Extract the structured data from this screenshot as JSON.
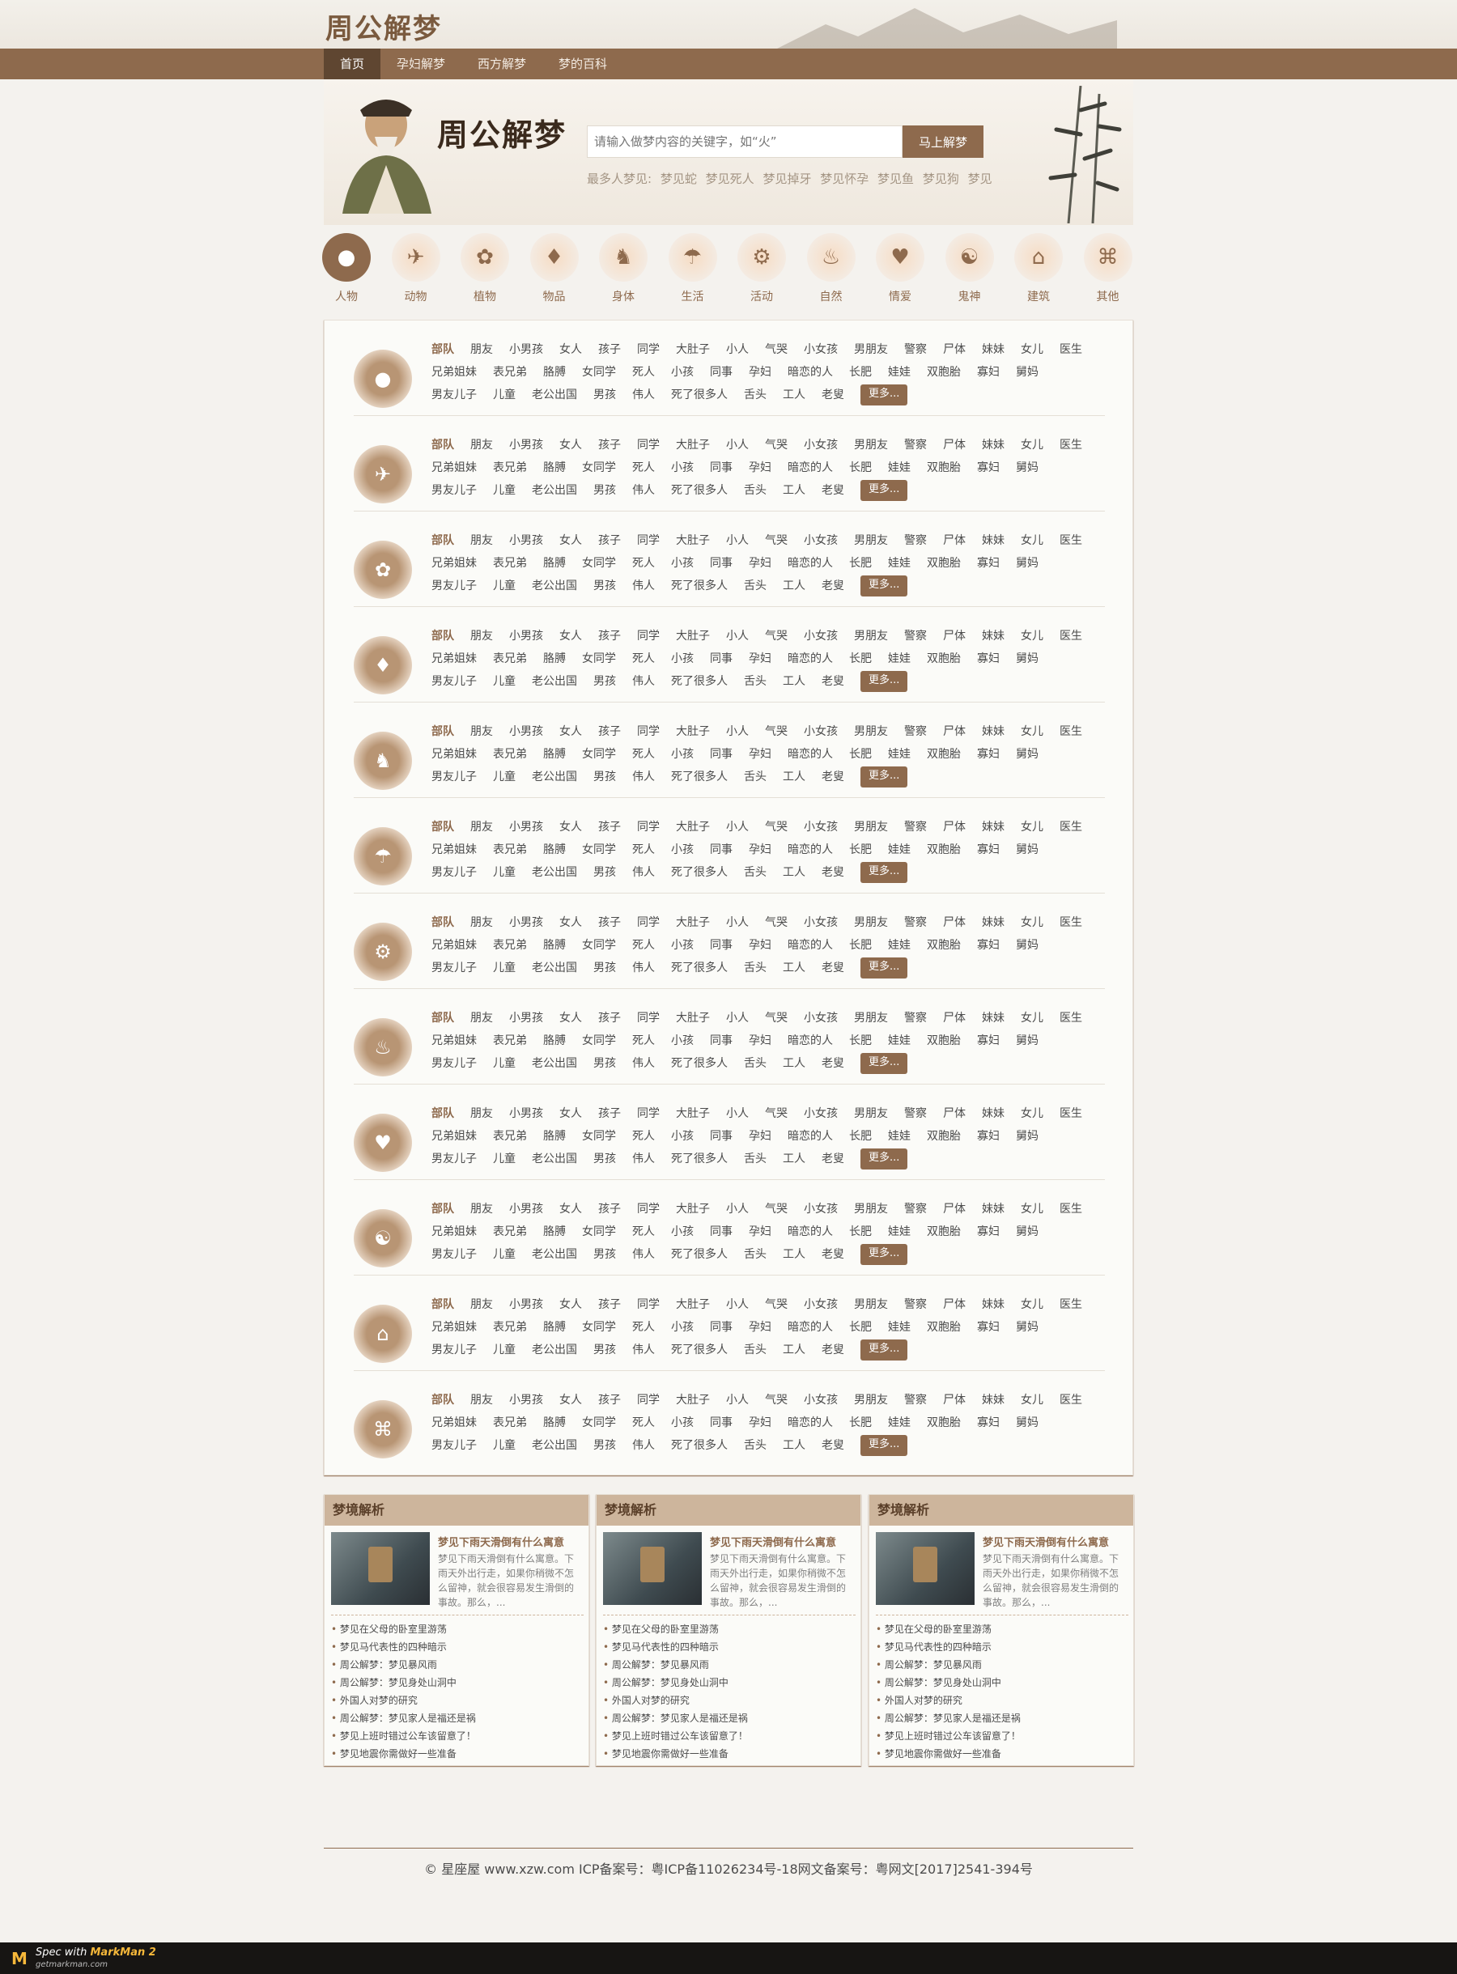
{
  "site": {
    "logo": "周公解梦",
    "brand": "周公解梦"
  },
  "nav": {
    "items": [
      "首页",
      "孕妇解梦",
      "西方解梦",
      "梦的百科"
    ]
  },
  "search": {
    "placeholder": "请输入做梦内容的关键字，如“火”",
    "button": "马上解梦"
  },
  "hot": {
    "label": "最多人梦见:",
    "items": [
      "梦见蛇",
      "梦见死人",
      "梦见掉牙",
      "梦见怀孕",
      "梦见鱼",
      "梦见狗",
      "梦见"
    ]
  },
  "categories": [
    {
      "label": "人物",
      "icon": "person-icon"
    },
    {
      "label": "动物",
      "icon": "bird-icon"
    },
    {
      "label": "植物",
      "icon": "flower-icon"
    },
    {
      "label": "物品",
      "icon": "shirt-icon"
    },
    {
      "label": "身体",
      "icon": "runner-icon"
    },
    {
      "label": "生活",
      "icon": "umbrella-icon"
    },
    {
      "label": "活动",
      "icon": "bicycle-icon"
    },
    {
      "label": "自然",
      "icon": "fire-icon"
    },
    {
      "label": "情爱",
      "icon": "heart-icon"
    },
    {
      "label": "鬼神",
      "icon": "yinyang-icon"
    },
    {
      "label": "建筑",
      "icon": "house-icon"
    },
    {
      "label": "其他",
      "icon": "command-icon"
    }
  ],
  "keywords": [
    "部队",
    "朋友",
    "小男孩",
    "女人",
    "孩子",
    "同学",
    "大肚子",
    "小人",
    "气哭",
    "小女孩",
    "男朋友",
    "警察",
    "尸体",
    "妹妹",
    "女儿",
    "医生",
    "兄弟姐妹",
    "表兄弟",
    "胳膊",
    "女同学",
    "死人",
    "小孩",
    "同事",
    "孕妇",
    "暗恋的人",
    "长肥",
    "娃娃",
    "双胞胎",
    "寡妇",
    "舅妈",
    "男友儿子",
    "儿童",
    "老公出国",
    "男孩",
    "伟人",
    "死了很多人",
    "舌头",
    "工人",
    "老叟"
  ],
  "more_label": "更多...",
  "articles": {
    "title": "梦境解析",
    "feature_title": "梦见下雨天滑倒有什么寓意",
    "feature_desc": "梦见下雨天滑倒有什么寓意。下雨天外出行走，如果你稍微不怎么留神，就会很容易发生滑倒的事故。那么，...",
    "list": [
      "梦见在父母的卧室里游荡",
      "梦见马代表性的四种暗示",
      "周公解梦：梦见暴风雨",
      "周公解梦：梦见身处山洞中",
      "外国人对梦的研究",
      "周公解梦：梦见家人是福还是祸",
      "梦见上班时错过公车该留意了！",
      "梦见地震你需做好一些准备"
    ]
  },
  "footer": {
    "text": "© 星座屋 www.xzw.com ICP备案号：粤ICP备11026234号-18网文备案号：粤网文[2017]2541-394号"
  },
  "markman": {
    "title": "Spec with ",
    "brand": "MarkMan 2",
    "url": "getmarkman.com"
  },
  "colors": {
    "primary": "#8e6a4d",
    "nav_active": "#5f4631",
    "panel_bg": "#fbfbf8",
    "text": "#4c4c4c",
    "muted": "#b2b2b2",
    "hero_bg": "#f7f3ed",
    "box_head": "#cdb59c"
  }
}
